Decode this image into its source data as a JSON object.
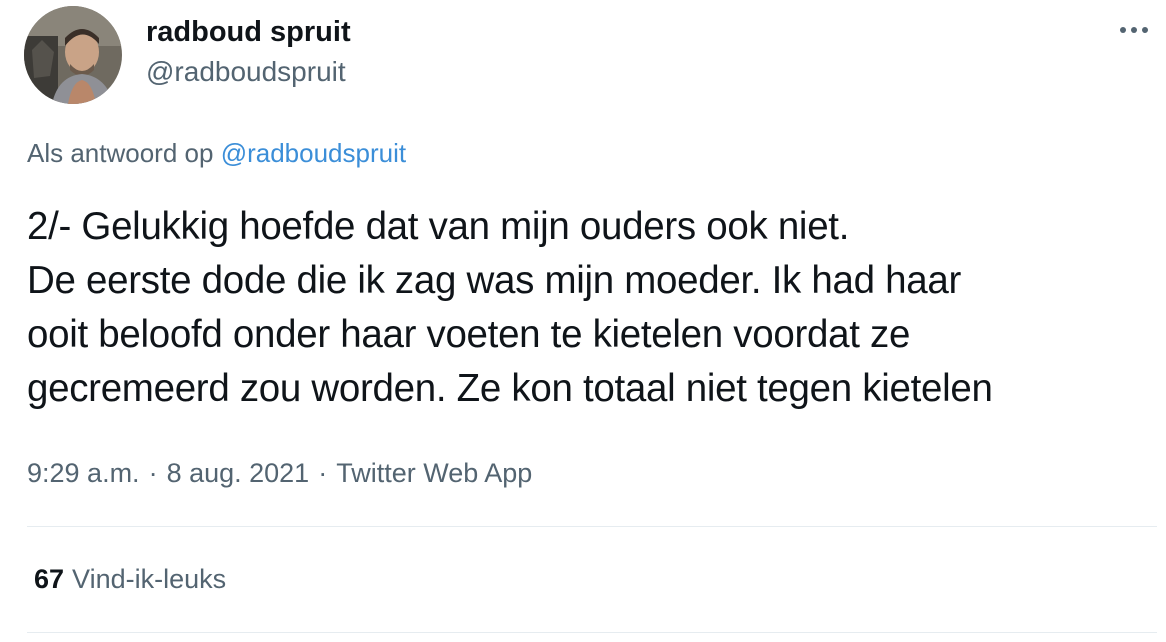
{
  "author": {
    "display_name": "radboud spruit",
    "handle": "@radboudspruit"
  },
  "menu": {
    "icon": "more-horizontal-icon"
  },
  "reply": {
    "prefix": "Als antwoord op",
    "mention": "@radboudspruit"
  },
  "tweet": {
    "lines": [
      "2/- Gelukkig hoefde dat van mijn ouders ook niet.",
      "De eerste dode die ik zag was mijn moeder. Ik had haar",
      "ooit beloofd onder haar voeten te kietelen voordat ze",
      "gecremeerd zou worden. Ze kon totaal niet tegen kietelen"
    ]
  },
  "meta": {
    "time": "9:29 a.m.",
    "separator": "·",
    "date": "8 aug. 2021",
    "app": "Twitter Web App"
  },
  "stats": {
    "likes_count": "67",
    "likes_label": "Vind-ik-leuks"
  },
  "colors": {
    "text": "#0f1419",
    "secondary": "#536471",
    "link": "#3b8ed8",
    "divider": "#e6ecf0"
  }
}
